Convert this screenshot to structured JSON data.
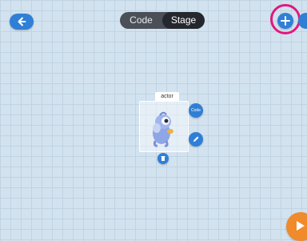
{
  "header": {
    "tabs": [
      {
        "label": "Code",
        "active": false
      },
      {
        "label": "Stage",
        "active": true
      }
    ],
    "icons": {
      "back": "back-arrow-icon",
      "add": "plus-icon",
      "more": "more-icon"
    }
  },
  "stage": {
    "actor": {
      "label": "actor",
      "code_label": "Code",
      "icons": {
        "edit": "pencil-icon",
        "delete": "trash-icon"
      }
    }
  },
  "footer": {
    "play_icon": "play-icon"
  },
  "colors": {
    "background": "#d2e2ef",
    "grid": "#c0d4e4",
    "primary": "#2f7fd6",
    "segment_bg": "#4b4f57",
    "segment_active": "#24272d",
    "highlight": "#e0197d",
    "play": "#f08a2a"
  }
}
